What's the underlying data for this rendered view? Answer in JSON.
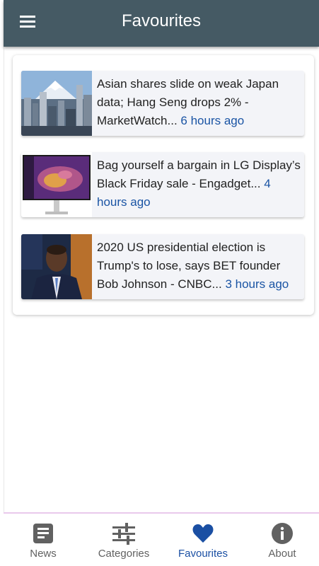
{
  "app_title": "Favourites",
  "icons": {
    "menu": "hamburger-menu-icon"
  },
  "news_items": [
    {
      "headline": "Asian shares slide on weak Japan data; Hang Seng drops 2% - MarketWatch...",
      "time": "6 hours ago",
      "thumbnail": "tokyo-skyline-mount-fuji"
    },
    {
      "headline": "Bag yourself a bargain in LG Display’s Black Friday sale - Engadget...",
      "time": "4 hours ago",
      "thumbnail": "lg-monitor"
    },
    {
      "headline": "2020 US presidential election is Trump's to lose, says BET founder Bob Johnson - CNBC...",
      "time": "3 hours ago",
      "thumbnail": "man-in-suit-interview"
    }
  ],
  "bottom_nav": [
    {
      "label": "News",
      "icon": "newspaper-icon",
      "active": false
    },
    {
      "label": "Categories",
      "icon": "sliders-icon",
      "active": false
    },
    {
      "label": "Favourites",
      "icon": "heart-icon",
      "active": true
    },
    {
      "label": "About",
      "icon": "info-icon",
      "active": false
    }
  ],
  "colors": {
    "app_bar": "#455a64",
    "accent_active": "#1a4fa3",
    "time_link": "#1a54a4",
    "nav_inactive": "#616161"
  }
}
